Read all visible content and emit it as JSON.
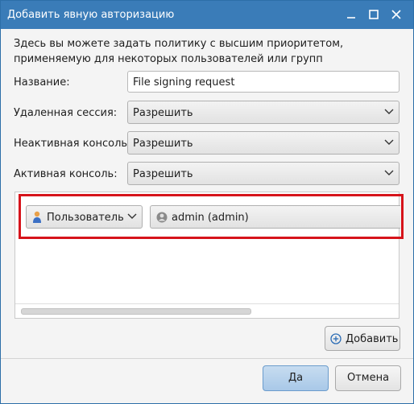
{
  "window": {
    "title": "Добавить явную авторизацию",
    "controls": {
      "minimize": "minimize-icon",
      "maximize": "maximize-icon",
      "close": "close-icon"
    }
  },
  "description": "Здесь вы можете задать политику с высшим приоритетом, применяемую для некоторых пользователей или групп",
  "form": {
    "name_label": "Название:",
    "name_value": "File signing request",
    "remote_session_label": "Удаленная сессия:",
    "remote_session_value": "Разрешить",
    "inactive_console_label": "Неактивная консоль:",
    "inactive_console_value": "Разрешить",
    "active_console_label": "Активная консоль:",
    "active_console_value": "Разрешить"
  },
  "identities": [
    {
      "type": "Пользователь",
      "type_icon": "user-icon",
      "name": "admin (admin)",
      "name_icon": "user-avatar-icon"
    }
  ],
  "buttons": {
    "add": "Добавить",
    "ok": "Да",
    "cancel": "Отмена"
  },
  "colors": {
    "titlebar": "#3a7cb8",
    "highlight": "#d6141b",
    "ok_button": "#b8d3ee"
  }
}
